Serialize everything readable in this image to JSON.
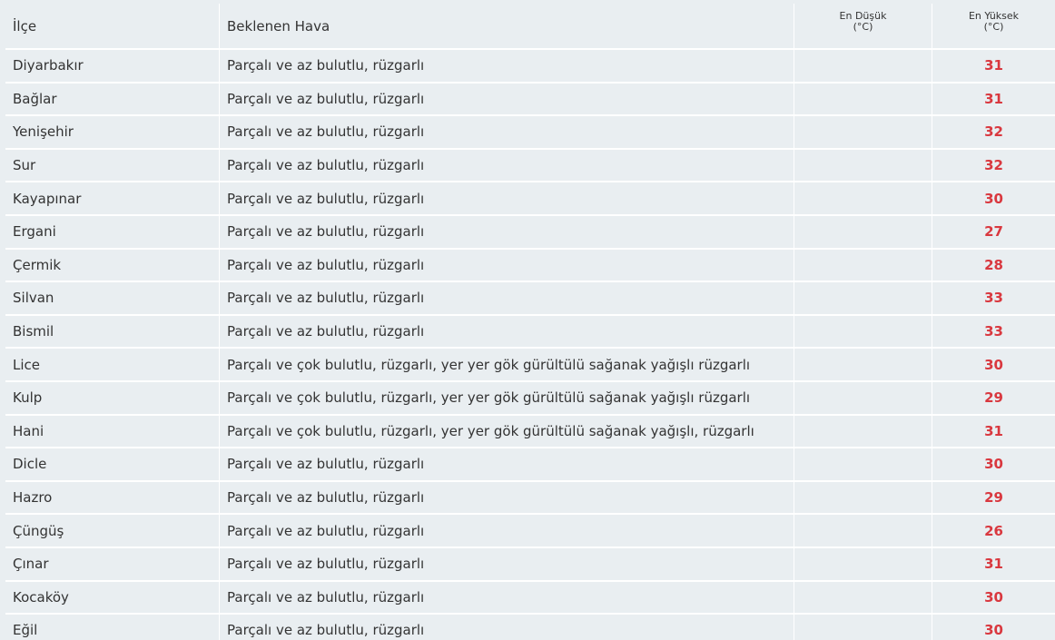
{
  "header": {
    "district": "İlçe",
    "weather": "Beklenen Hava",
    "min_line1": "En Düşük",
    "min_line2": "(°C)",
    "max_line1": "En Yüksek",
    "max_line2": "(°C)"
  },
  "rows": [
    {
      "district": "Diyarbakır",
      "weather": "Parçalı ve az bulutlu, rüzgarlı",
      "min": "",
      "max": "31"
    },
    {
      "district": "Bağlar",
      "weather": "Parçalı ve az bulutlu, rüzgarlı",
      "min": "",
      "max": "31"
    },
    {
      "district": "Yenişehir",
      "weather": "Parçalı ve az bulutlu, rüzgarlı",
      "min": "",
      "max": "32"
    },
    {
      "district": "Sur",
      "weather": "Parçalı ve az bulutlu, rüzgarlı",
      "min": "",
      "max": "32"
    },
    {
      "district": "Kayapınar",
      "weather": "Parçalı ve az bulutlu, rüzgarlı",
      "min": "",
      "max": "30"
    },
    {
      "district": "Ergani",
      "weather": "Parçalı ve az bulutlu, rüzgarlı",
      "min": "",
      "max": "27"
    },
    {
      "district": "Çermik",
      "weather": "Parçalı ve az bulutlu, rüzgarlı",
      "min": "",
      "max": "28"
    },
    {
      "district": "Silvan",
      "weather": "Parçalı ve az bulutlu, rüzgarlı",
      "min": "",
      "max": "33"
    },
    {
      "district": "Bismil",
      "weather": "Parçalı ve az bulutlu, rüzgarlı",
      "min": "",
      "max": "33"
    },
    {
      "district": "Lice",
      "weather": "Parçalı ve çok bulutlu, rüzgarlı, yer yer gök gürültülü sağanak yağışlı rüzgarlı",
      "min": "",
      "max": "30"
    },
    {
      "district": "Kulp",
      "weather": "Parçalı ve çok bulutlu, rüzgarlı, yer yer gök gürültülü sağanak yağışlı rüzgarlı",
      "min": "",
      "max": "29"
    },
    {
      "district": "Hani",
      "weather": "Parçalı ve çok bulutlu, rüzgarlı, yer yer gök gürültülü sağanak yağışlı, rüzgarlı",
      "min": "",
      "max": "31"
    },
    {
      "district": "Dicle",
      "weather": "Parçalı ve az bulutlu, rüzgarlı",
      "min": "",
      "max": "30"
    },
    {
      "district": "Hazro",
      "weather": "Parçalı ve az bulutlu, rüzgarlı",
      "min": "",
      "max": "29"
    },
    {
      "district": "Çüngüş",
      "weather": "Parçalı ve az bulutlu, rüzgarlı",
      "min": "",
      "max": "26"
    },
    {
      "district": "Çınar",
      "weather": "Parçalı ve az bulutlu, rüzgarlı",
      "min": "",
      "max": "31"
    },
    {
      "district": "Kocaköy",
      "weather": "Parçalı ve az bulutlu, rüzgarlı",
      "min": "",
      "max": "30"
    },
    {
      "district": "Eğil",
      "weather": "Parçalı ve az bulutlu, rüzgarlı",
      "min": "",
      "max": "30"
    }
  ],
  "colors": {
    "max_temp": "#d9383f",
    "row_bg": "#e9eef1",
    "grid": "#ffffff"
  }
}
